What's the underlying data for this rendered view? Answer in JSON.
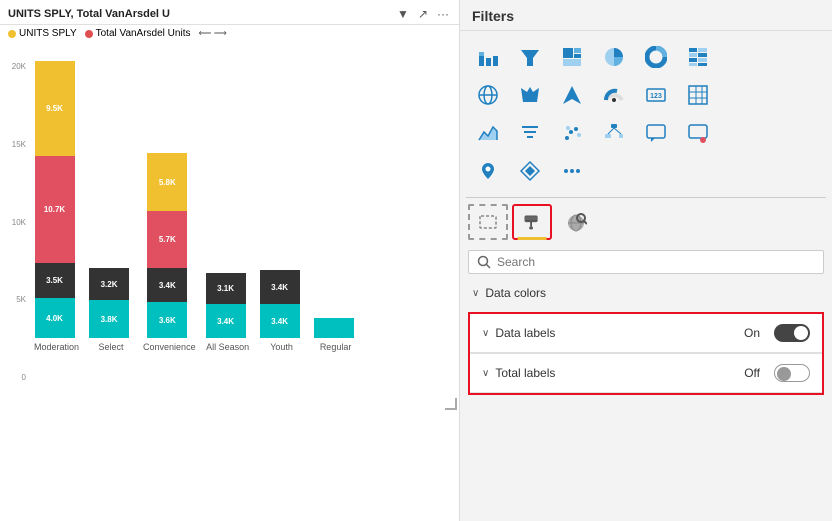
{
  "chart": {
    "title": "UNITS SPLY, Total VanArsdel U",
    "subtitle": "UNITS SPLY",
    "legend": [
      {
        "label": "UNITS SPLY",
        "color": "#e0e050"
      },
      {
        "label": "Total VanArsdel Units",
        "color": "#e05050"
      }
    ],
    "yAxisLabels": [
      "20K",
      "15K",
      "10K",
      "5K",
      "0"
    ],
    "barGroups": [
      {
        "label": "Moderation",
        "segments": [
          {
            "value": "9.5K",
            "height": 95,
            "color": "#f0c030"
          },
          {
            "value": "10.7K",
            "height": 107,
            "color": "#e05060"
          },
          {
            "value": "3.5K",
            "height": 35,
            "color": "#333"
          },
          {
            "value": "4.0K",
            "height": 40,
            "color": "#00bfbf"
          }
        ]
      },
      {
        "label": "Select",
        "segments": [
          {
            "value": "3.2K",
            "height": 32,
            "color": "#333"
          },
          {
            "value": "3.8K",
            "height": 38,
            "color": "#00bfbf"
          }
        ]
      },
      {
        "label": "Convenience",
        "segments": [
          {
            "value": "5.8K",
            "height": 58,
            "color": "#f0c030"
          },
          {
            "value": "5.7K",
            "height": 57,
            "color": "#e05060"
          },
          {
            "value": "3.4K",
            "height": 34,
            "color": "#333"
          },
          {
            "value": "3.6K",
            "height": 36,
            "color": "#00bfbf"
          }
        ]
      },
      {
        "label": "All Season",
        "segments": [
          {
            "value": "3.1K",
            "height": 31,
            "color": "#333"
          },
          {
            "value": "3.4K",
            "height": 34,
            "color": "#00bfbf"
          }
        ]
      },
      {
        "label": "Youth",
        "segments": [
          {
            "value": "3.4K",
            "height": 34,
            "color": "#333"
          },
          {
            "value": "3.4K",
            "height": 34,
            "color": "#00bfbf"
          }
        ]
      },
      {
        "label": "Regular",
        "segments": [
          {
            "value": "",
            "height": 20,
            "color": "#00bfbf"
          }
        ]
      }
    ]
  },
  "right_panel": {
    "title": "Filters",
    "search": {
      "placeholder": "Search",
      "value": ""
    },
    "format_icon_label": "Format visual (paint roller)",
    "analytics_icon_label": "Analytics (globe/ball)",
    "data_colors_label": "Data colors",
    "data_labels": {
      "label": "Data labels",
      "value": "On",
      "enabled": true
    },
    "total_labels": {
      "label": "Total labels",
      "value": "Off",
      "enabled": false
    },
    "viz_icons": [
      "bar-chart-icon",
      "funnel-icon",
      "treemap-icon",
      "pie-chart-icon",
      "donut-icon",
      "matrix-icon",
      "globe-icon",
      "filled-map-icon",
      "arrow-icon",
      "gauge-icon",
      "number-card-icon",
      "table-icon",
      "area-chart-icon",
      "filter-icon",
      "grid-icon",
      "scatter-icon",
      "more-icon2",
      "speech-bubble-icon",
      "page-icon",
      "map-pin-icon",
      "diamond-icon",
      "ellipsis-icon"
    ],
    "more_label": "..."
  }
}
